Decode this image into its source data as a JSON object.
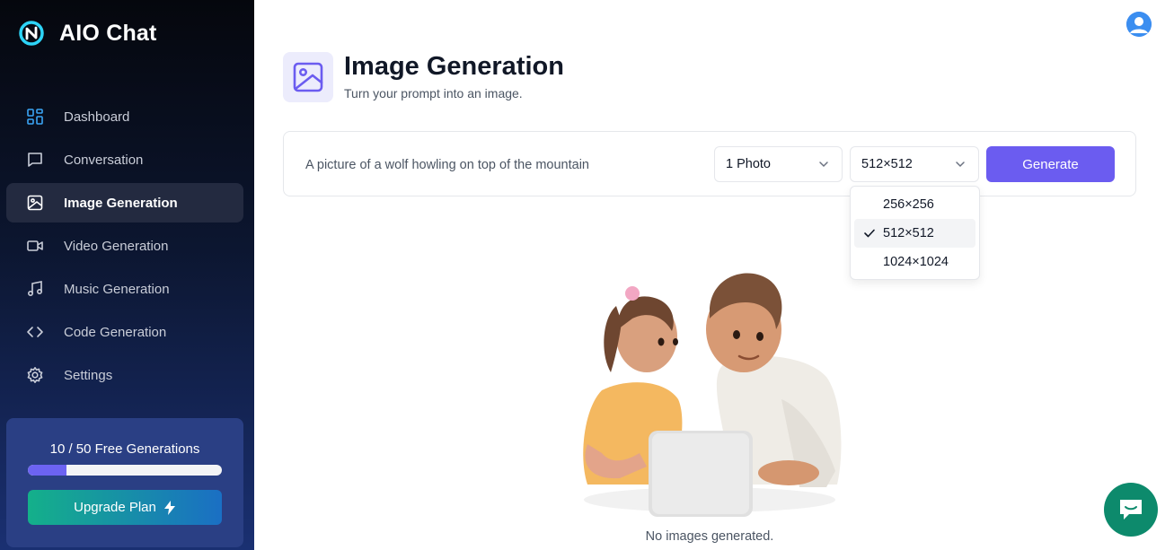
{
  "brand": {
    "name": "AIO Chat"
  },
  "sidebar": {
    "items": [
      {
        "label": "Dashboard",
        "icon": "dashboard-icon"
      },
      {
        "label": "Conversation",
        "icon": "chat-bubble-icon"
      },
      {
        "label": "Image Generation",
        "icon": "image-icon",
        "active": true
      },
      {
        "label": "Video Generation",
        "icon": "video-icon"
      },
      {
        "label": "Music Generation",
        "icon": "music-note-icon"
      },
      {
        "label": "Code Generation",
        "icon": "code-icon"
      },
      {
        "label": "Settings",
        "icon": "gear-icon"
      }
    ],
    "usage": {
      "text": "10 / 50 Free Generations",
      "progress": 0.2
    },
    "upgrade_label": "Upgrade Plan"
  },
  "header": {
    "title": "Image Generation",
    "subtitle": "Turn your prompt into an image."
  },
  "prompt": {
    "value": "A picture of a wolf howling on top of the mountain",
    "count_selected": "1 Photo",
    "size_selected": "512×512",
    "generate_label": "Generate"
  },
  "size_dropdown": {
    "options": [
      "256×256",
      "512×512",
      "1024×1024"
    ],
    "selected": "512×512"
  },
  "empty_state": {
    "text": "No images generated."
  },
  "colors": {
    "accent": "#6b5cf0",
    "fab": "#0d8a6c",
    "upgrade_from": "#14b08a",
    "upgrade_to": "#1a6fc4"
  }
}
